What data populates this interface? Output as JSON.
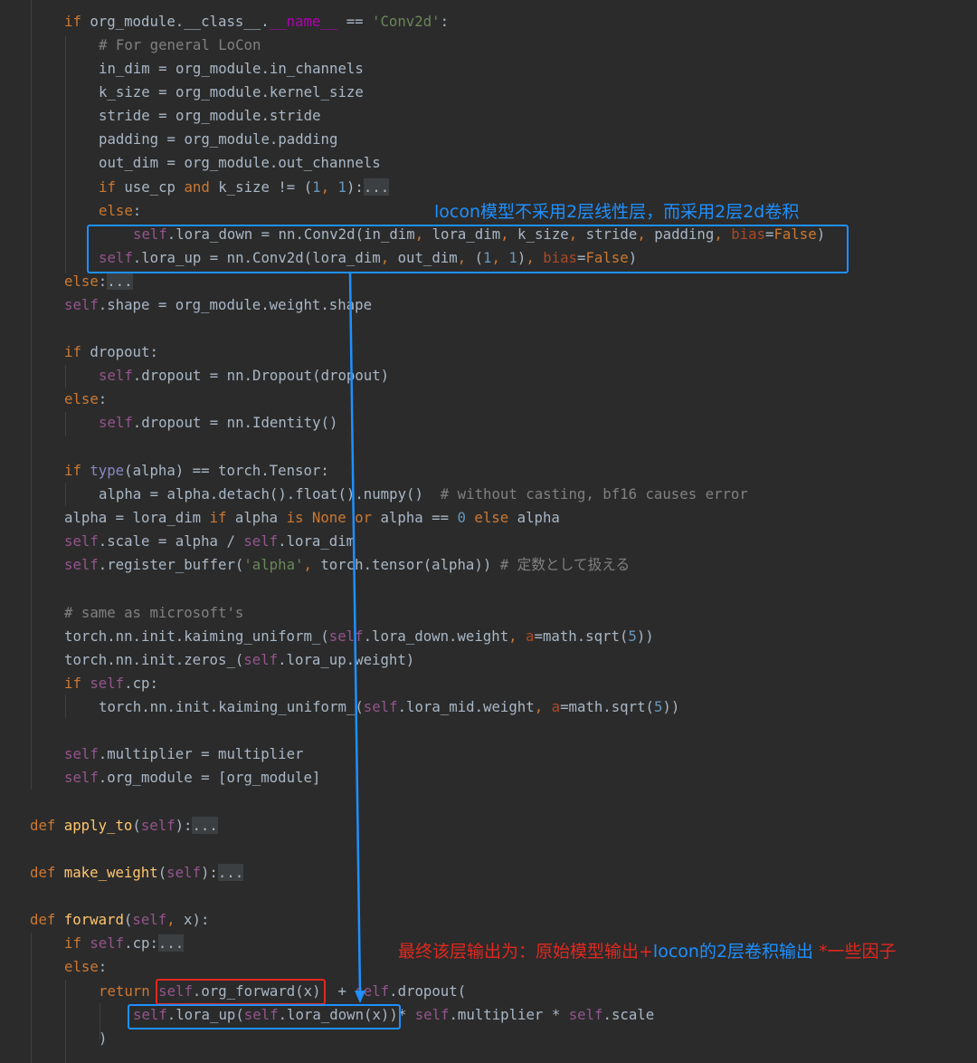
{
  "code": {
    "l01": {
      "p1": "if",
      "p2": " org_module.__class__.",
      "p3": "__name__",
      "p4": " == ",
      "p5": "'Conv2d'",
      "p6": ":"
    },
    "l02": {
      "p1": "# For general LoCon"
    },
    "l03": {
      "p1": "in_dim = org_module.in_channels"
    },
    "l04": {
      "p1": "k_size = org_module.kernel_size"
    },
    "l05": {
      "p1": "stride = org_module.stride"
    },
    "l06": {
      "p1": "padding = org_module.padding"
    },
    "l07": {
      "p1": "out_dim = org_module.out_channels"
    },
    "l08": {
      "p1": "if",
      "p2": " use_cp ",
      "p3": "and",
      "p4": " k_size != (",
      "p5": "1",
      ",": ",",
      "p6": " ",
      "p7": "1",
      "p8": "):",
      "p9": "..."
    },
    "l09": {
      "p1": "else",
      "p2": ":"
    },
    "l10": {
      "p1": "self",
      "p2": ".lora_down = nn.Conv2d(in_dim",
      ",a": ",",
      "p3": " lora_dim",
      ",b": ",",
      "p4": " k_size",
      ",c": ",",
      "p5": " stride",
      ",d": ",",
      "p6": " padding",
      ",e": ",",
      "p7": " ",
      "p8": "bias",
      "p9": "=",
      "p10": "False",
      "p11": ")"
    },
    "l11": {
      "p1": "self",
      "p2": ".lora_up = nn.Conv2d(lora_dim",
      ",a": ",",
      "p3": " out_dim",
      ",b": ",",
      "p4": " (",
      "p5": "1",
      ",c": ",",
      "p6": " ",
      "p7": "1",
      "p8": ")",
      ",d": ",",
      "p9": " ",
      "p10": "bias",
      "p11": "=",
      "p12": "False",
      "p13": ")"
    },
    "l12": {
      "p1": "else",
      "p2": ":",
      "p3": "..."
    },
    "l13": {
      "p1": "self",
      "p2": ".shape = org_module.weight.shape"
    },
    "l14": {
      "p1": "if",
      "p2": " dropout:"
    },
    "l15": {
      "p1": "self",
      "p2": ".dropout = nn.Dropout(dropout)"
    },
    "l16": {
      "p1": "else",
      "p2": ":"
    },
    "l17": {
      "p1": "self",
      "p2": ".dropout = nn.Identity()"
    },
    "l18": {
      "p1": "if",
      "p2": " ",
      "p3": "type",
      "p4": "(alpha) == torch.Tensor:"
    },
    "l19": {
      "p1": "alpha = alpha.detach().float().numpy()  ",
      "p2": "# without casting, bf16 causes error"
    },
    "l20": {
      "p1": "alpha = lora_dim ",
      "p2": "if",
      "p3": " alpha ",
      "p4": "is",
      "p5": " ",
      "p6": "None",
      "p7": " ",
      "p8": "or",
      "p9": " alpha == ",
      "p10": "0",
      "p11": " ",
      "p12": "else",
      "p13": " alpha"
    },
    "l21": {
      "p1": "self",
      "p2": ".scale = alpha / ",
      "p3": "self",
      "p4": ".lora_dim"
    },
    "l22": {
      "p1": "self",
      "p2": ".register_buffer(",
      "p3": "'alpha'",
      ",a": ",",
      "p4": " torch.tensor(alpha)) ",
      "p5": "# 定数として扱える"
    },
    "l23": {
      "p1": "# same as microsoft's"
    },
    "l24": {
      "p1": "torch.nn.init.kaiming_uniform_(",
      "p2": "self",
      "p3": ".lora_down.weight",
      ",a": ",",
      "p4": " ",
      "p5": "a",
      "p6": "=math.sqrt(",
      "p7": "5",
      "p8": "))"
    },
    "l25": {
      "p1": "torch.nn.init.zeros_(",
      "p2": "self",
      "p3": ".lora_up.weight)"
    },
    "l26": {
      "p1": "if",
      "p2": " ",
      "p3": "self",
      "p4": ".cp:"
    },
    "l27": {
      "p1": "torch.nn.init.kaiming_uniform_(",
      "p2": "self",
      "p3": ".lora_mid.weight",
      ",a": ",",
      "p4": " ",
      "p5": "a",
      "p6": "=math.sqrt(",
      "p7": "5",
      "p8": "))"
    },
    "l28": {
      "p1": "self",
      "p2": ".multiplier = multiplier"
    },
    "l29": {
      "p1": "self",
      "p2": ".org_module = [org_module]"
    },
    "l30": {
      "p1": "def",
      "p2": " ",
      "p3": "apply_to",
      "p4": "(",
      "p5": "self",
      "p6": "):",
      "p7": "..."
    },
    "l31": {
      "p1": "def",
      "p2": " ",
      "p3": "make_weight",
      "p4": "(",
      "p5": "self",
      "p6": "):",
      "p7": "..."
    },
    "l32": {
      "p1": "def",
      "p2": " ",
      "p3": "forward",
      "p4": "(",
      "p5": "self",
      ",a": ",",
      "p6": " x):"
    },
    "l33": {
      "p1": "if",
      "p2": " ",
      "p3": "self",
      "p4": ".cp:",
      "p5": "..."
    },
    "l34": {
      "p1": "else",
      "p2": ":"
    },
    "l35": {
      "p1": "return",
      "p2": " ",
      "p3": "self",
      "p4": ".org_forward(x)",
      "p5": "  + ",
      "p6": "self",
      "p7": ".dropout("
    },
    "l36": {
      "p1": "self",
      "p2": ".lora_up(",
      "p3": "self",
      "p4": ".lora_down(x))",
      "p5": "* ",
      "p6": "self",
      "p7": ".multiplier * ",
      "p8": "self",
      "p9": ".scale"
    },
    "l37": {
      "p1": ")"
    }
  },
  "annotations": {
    "top": "locon模型不采用2层线性层，而采用2层2d卷积",
    "bottom_red1": "最终该层输出为：原始模型输出+",
    "bottom_blue": "locon的2层卷积输出",
    "bottom_red2": " *一些因子"
  },
  "colors": {
    "background": "#2b2b2b",
    "default_text": "#a9b7c6",
    "keyword": "#cc7832",
    "self": "#94558d",
    "string": "#6a8759",
    "comment": "#808080",
    "number": "#6897bb",
    "function_def": "#ffc66d",
    "annotation_blue": "#1e90ff",
    "annotation_red": "#e0281e"
  }
}
